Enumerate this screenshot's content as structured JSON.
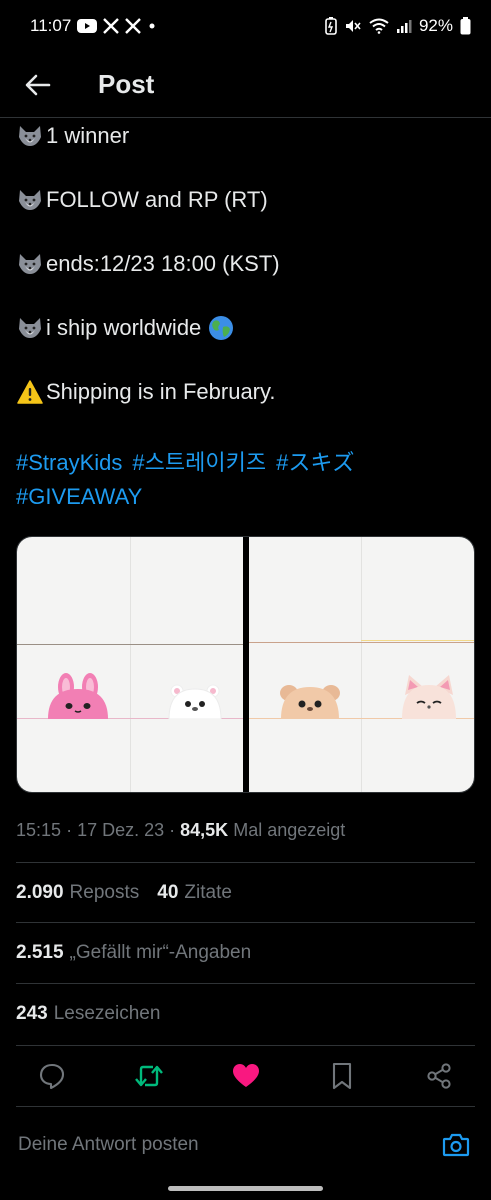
{
  "status_bar": {
    "time": "11:07",
    "battery": "92%",
    "notification_icons": [
      "youtube-icon",
      "x-logo-icon",
      "x-logo-icon",
      "dot-icon"
    ],
    "system_icons": [
      "battery-saver-icon",
      "mute-icon",
      "wifi-icon",
      "signal-icon",
      "battery-icon"
    ]
  },
  "header": {
    "title": "Post"
  },
  "tweet": {
    "lines": [
      {
        "emoji": "wolf-emoji-icon",
        "text": "1 winner"
      },
      {
        "emoji": "wolf-emoji-icon",
        "text": "FOLLOW and RP (RT)"
      },
      {
        "emoji": "wolf-emoji-icon",
        "text": "ends:12/23 18:00 (KST)"
      },
      {
        "emoji": "wolf-emoji-icon",
        "text": "i ship worldwide",
        "trailing_emoji": "globe-emoji-icon"
      },
      {
        "emoji": "warning-emoji-icon",
        "text": "Shipping is in February."
      }
    ],
    "hashtags": [
      "#StrayKids",
      "#스트레이키즈",
      "#スキズ",
      "#GIVEAWAY"
    ]
  },
  "media": {
    "photos": [
      {
        "characters": [
          "pink-rabbit-plush",
          "white-bear-plush"
        ]
      },
      {
        "characters": [
          "beige-puppy-plush",
          "fox-plush"
        ]
      }
    ]
  },
  "meta": {
    "time": "15:15",
    "date": "17 Dez. 23",
    "views_count": "84,5K",
    "views_label": "Mal angezeigt"
  },
  "stats": {
    "reposts_count": "2.090",
    "reposts_label": "Reposts",
    "quotes_count": "40",
    "quotes_label": "Zitate",
    "likes_count": "2.515",
    "likes_label": "„Gefällt mir“-Angaben",
    "bookmarks_count": "243",
    "bookmarks_label": "Lesezeichen"
  },
  "actions": [
    "reply-icon",
    "repost-icon",
    "like-icon",
    "bookmark-icon",
    "share-icon"
  ],
  "colors": {
    "background": "#000000",
    "text": "#e7e9ea",
    "secondary": "#71767b",
    "link": "#1d9bf0",
    "repost_active": "#00ba7c",
    "like_active": "#f91880"
  },
  "reply": {
    "placeholder": "Deine Antwort posten"
  }
}
